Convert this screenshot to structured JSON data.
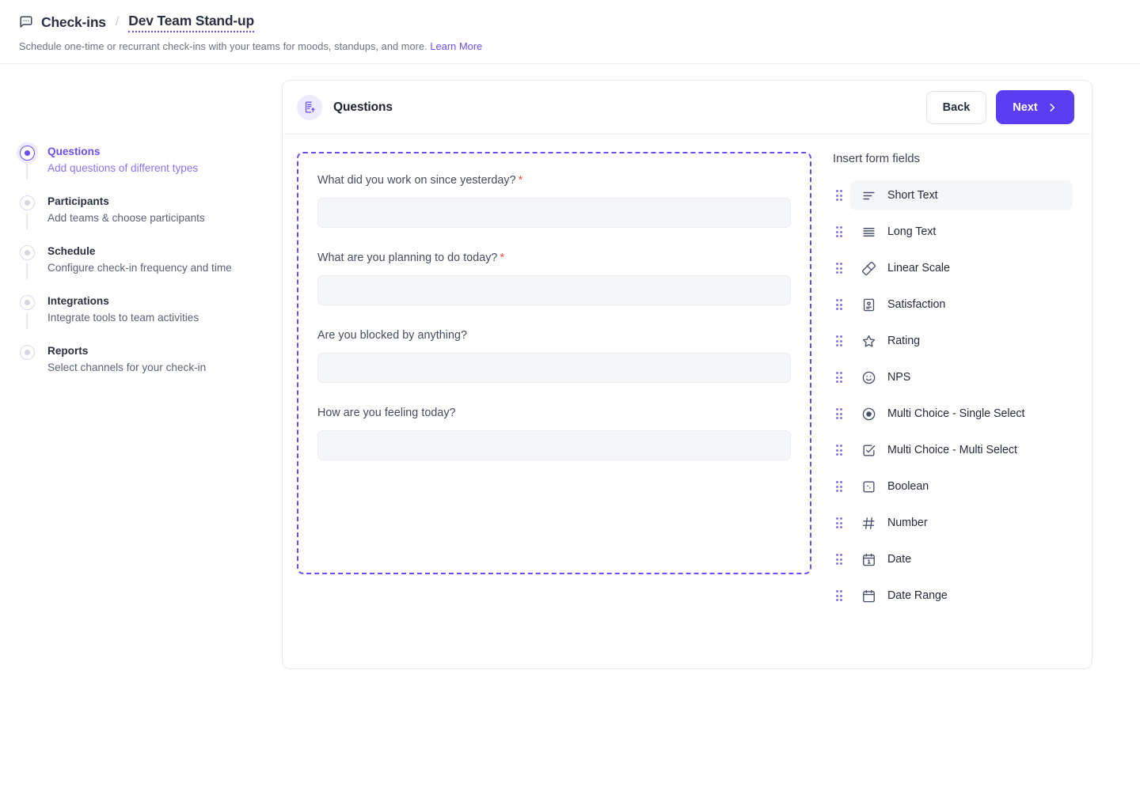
{
  "header": {
    "breadcrumb_icon": "chat-bubble-icon",
    "breadcrumb_root": "Check-ins",
    "breadcrumb_separator": "/",
    "breadcrumb_current": "Dev Team Stand-up",
    "subtitle_text": "Schedule one-time or recurrant check-ins with your teams for moods, standups, and more.",
    "learn_more_label": "Learn More"
  },
  "stepper": {
    "steps": [
      {
        "title": "Questions",
        "desc": "Add questions of different types",
        "active": true
      },
      {
        "title": "Participants",
        "desc": "Add teams & choose participants",
        "active": false
      },
      {
        "title": "Schedule",
        "desc": "Configure check-in frequency and time",
        "active": false
      },
      {
        "title": "Integrations",
        "desc": "Integrate tools to team activities",
        "active": false
      },
      {
        "title": "Reports",
        "desc": "Select channels for your check-in",
        "active": false
      }
    ]
  },
  "card": {
    "icon": "form-document-icon",
    "title": "Questions",
    "back_label": "Back",
    "next_label": "Next",
    "next_icon": "chevron-right-icon"
  },
  "form": {
    "questions": [
      {
        "label": "What did you work on since yesterday?",
        "required": true,
        "value": "",
        "placeholder": ""
      },
      {
        "label": "What are you planning to do today?",
        "required": true,
        "value": "",
        "placeholder": ""
      },
      {
        "label": "Are you blocked by anything?",
        "required": false,
        "value": "",
        "placeholder": ""
      },
      {
        "label": "How are you feeling today?",
        "required": false,
        "value": "",
        "placeholder": ""
      }
    ],
    "required_marker": "*"
  },
  "fields_panel": {
    "title": "Insert form fields",
    "items": [
      {
        "label": "Short Text",
        "icon": "short-text-icon",
        "selected": true
      },
      {
        "label": "Long Text",
        "icon": "long-text-icon",
        "selected": false
      },
      {
        "label": "Linear Scale",
        "icon": "ruler-icon",
        "selected": false
      },
      {
        "label": "Satisfaction",
        "icon": "satisfaction-icon",
        "selected": false
      },
      {
        "label": "Rating",
        "icon": "star-icon",
        "selected": false
      },
      {
        "label": "NPS",
        "icon": "smiley-icon",
        "selected": false
      },
      {
        "label": "Multi Choice - Single Select",
        "icon": "radio-icon",
        "selected": false
      },
      {
        "label": "Multi Choice - Multi Select",
        "icon": "checkbox-icon",
        "selected": false
      },
      {
        "label": "Boolean",
        "icon": "boolean-icon",
        "selected": false
      },
      {
        "label": "Number",
        "icon": "hash-icon",
        "selected": false
      },
      {
        "label": "Date",
        "icon": "calendar-icon",
        "selected": false
      },
      {
        "label": "Date Range",
        "icon": "calendar-range-icon",
        "selected": false
      }
    ]
  },
  "colors": {
    "accent": "#5b3df2",
    "accent_light": "#8a73f2",
    "required": "#e8503a",
    "text": "#2b3040",
    "muted": "#6b7280"
  }
}
